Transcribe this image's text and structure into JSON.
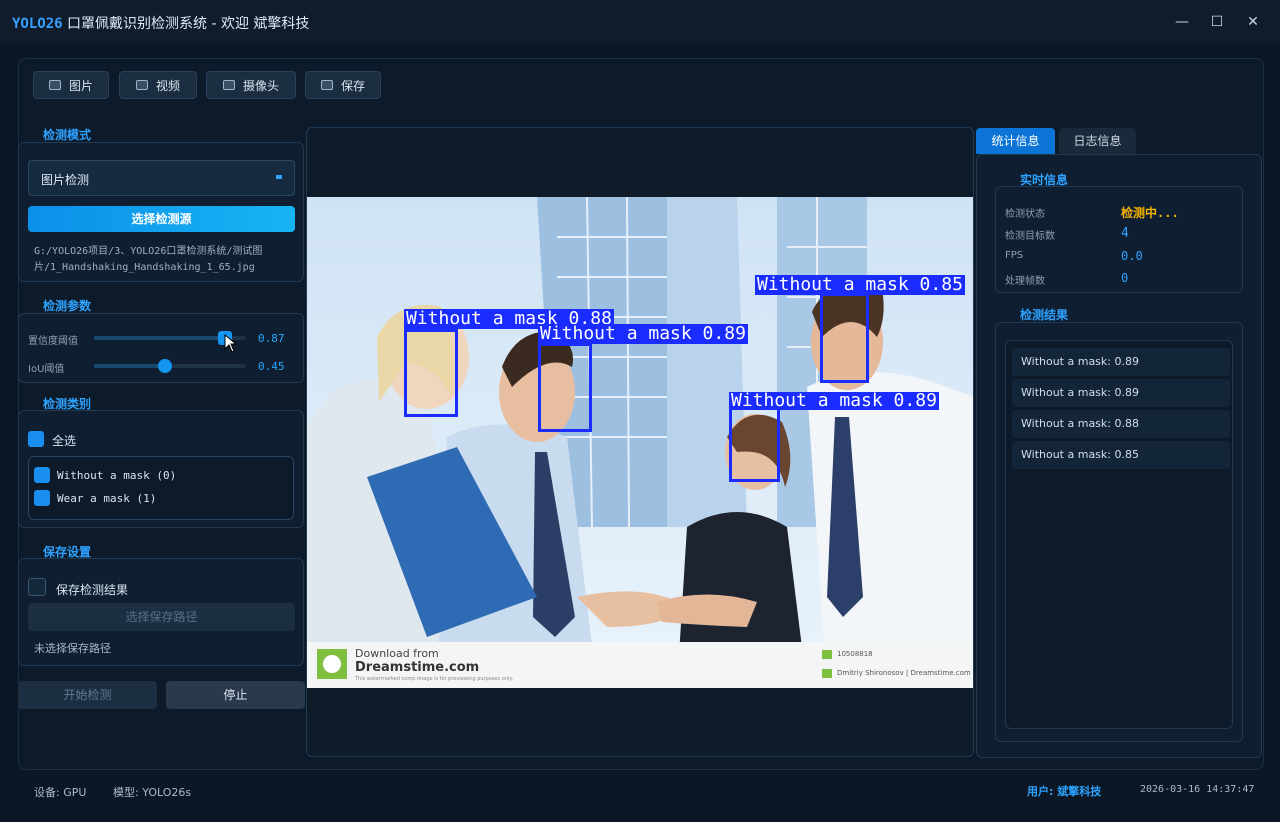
{
  "window": {
    "brand": "YOLO26",
    "title_rest": " 口罩佩戴识别检测系统 - 欢迎 斌擎科技",
    "minimize": "—",
    "maximize": "☐",
    "close": "✕"
  },
  "toolbar": {
    "image_label": "图片",
    "video_label": "视频",
    "camera_label": "摄像头",
    "save_label": "保存"
  },
  "left": {
    "mode_heading": "检测模式",
    "mode_selected": "图片检测",
    "select_source_label": "选择检测源",
    "source_path": "G:/YOLO26项目/3、YOLO26口罩检测系统/测试图片/1_Handshaking_Handshaking_1_65.jpg",
    "params_heading": "检测参数",
    "confidence_label": "置信度阈值",
    "confidence_value": "0.87",
    "confidence_level": 0.87,
    "iou_label": "IoU阈值",
    "iou_value": "0.45",
    "iou_level": 0.45,
    "classes_heading": "检测类别",
    "select_all_label": "全选",
    "classes": [
      {
        "label": "Without a mask (0)"
      },
      {
        "label": "Wear a mask (1)"
      }
    ],
    "save_heading": "保存设置",
    "save_results_label": "保存检测结果",
    "select_save_path_label": "选择保存路径",
    "save_path_status": "未选择保存路径",
    "start_label": "开始检测",
    "stop_label": "停止"
  },
  "viewer": {
    "detections": [
      {
        "label": "Without a mask 0.88"
      },
      {
        "label": "Without a mask 0.89"
      },
      {
        "label": "Without a mask 0.89"
      },
      {
        "label": "Without a mask 0.85"
      }
    ],
    "watermark_title_1": "Download from",
    "watermark_title_2": "Dreamstime.com",
    "watermark_sub": "This watermarked comp image is for previewing purposes only.",
    "watermark_id": "10508818",
    "watermark_author": "Dmitriy Shironosov | Dreamstime.com"
  },
  "right": {
    "tab_stats": "统计信息",
    "tab_log": "日志信息",
    "realtime_heading": "实时信息",
    "status_label": "检测状态",
    "status_value": "检测中...",
    "count_label": "检测目标数",
    "count_value": "4",
    "fps_label": "FPS",
    "fps_value": "0.0",
    "frames_label": "处理帧数",
    "frames_value": "0",
    "results_heading": "检测结果",
    "results": [
      "Without a mask: 0.89",
      "Without a mask: 0.89",
      "Without a mask: 0.88",
      "Without a mask: 0.85"
    ]
  },
  "status": {
    "device": "设备: GPU",
    "model": "模型: YOLO26s",
    "user": "用户: 斌擎科技",
    "datetime": "2026-03-16 14:37:47"
  },
  "colors": {
    "accent": "#2ea2ff",
    "box": "#1a2cff",
    "status_yellow": "#f5b400"
  }
}
